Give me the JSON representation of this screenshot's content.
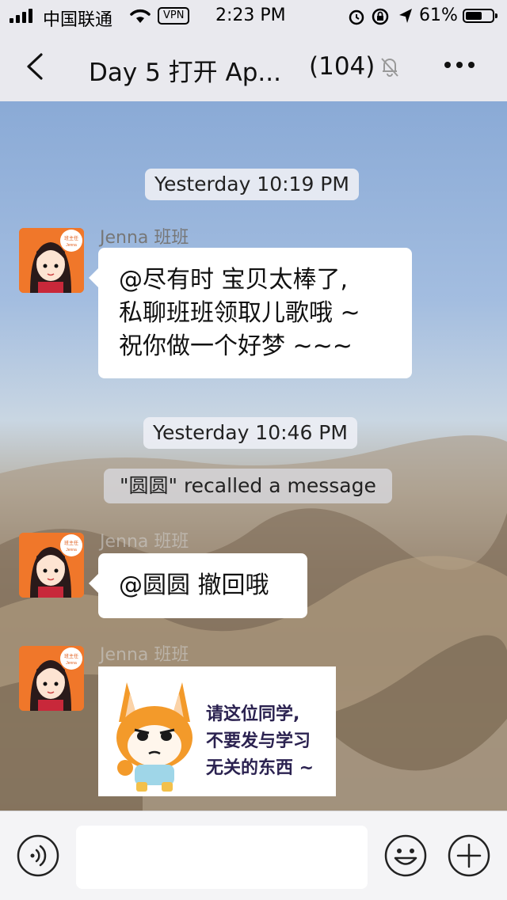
{
  "status_bar": {
    "carrier": "中国联通",
    "vpn": "VPN",
    "time": "2:23 PM",
    "battery_pct": "61%",
    "battery_level": 0.61
  },
  "nav": {
    "title": "Day 5 打开 Ap...",
    "member_count": "(104)"
  },
  "messages": {
    "ts1": "Yesterday 10:19 PM",
    "ts2": "Yesterday 10:46 PM",
    "recalled": "\"圆圆\" recalled a message",
    "sender1": "Jenna 班班",
    "sender2": "Jenna 班班",
    "sender3": "Jenna 班班",
    "msg1": [
      "@尽有时 宝贝太棒了,",
      "私聊班班领取儿歌哦 ~",
      "祝你做一个好梦 ~~~"
    ],
    "msg2": "@圆圆 撤回哦",
    "avatar_badge": "班主任",
    "avatar_name": "Jenna",
    "sticker_lines": [
      "请这位同学,",
      "不要发与学习",
      "无关的东西 ~"
    ]
  },
  "input": {
    "value": ""
  }
}
